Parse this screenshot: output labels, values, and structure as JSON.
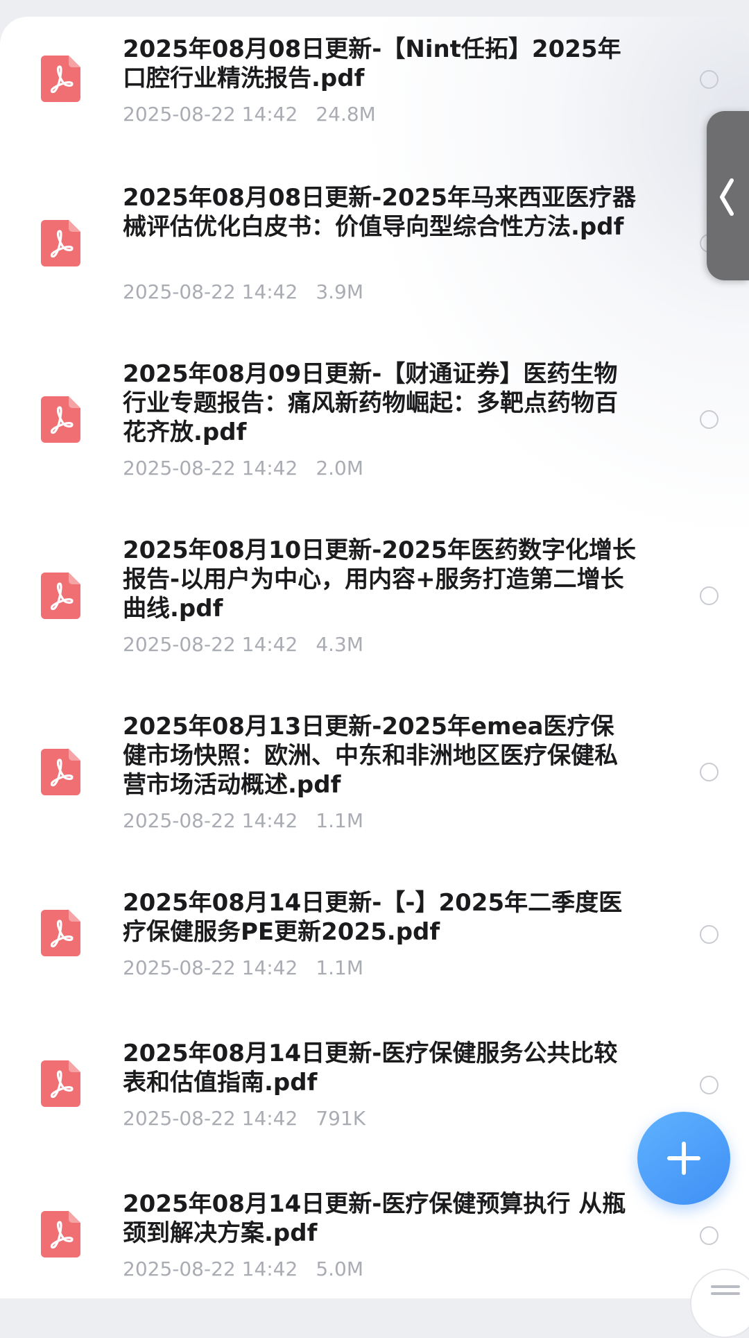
{
  "files": [
    {
      "name": "2025年08月08日更新-【Nint任拓】2025年口腔行业精洗报告.pdf",
      "date": "2025-08-22 14:42",
      "size": "24.8M"
    },
    {
      "name": "2025年08月08日更新-2025年马来西亚医疗器械评估优化白皮书：价值导向型综合性方法.pdf",
      "date": "2025-08-22 14:42",
      "size": "3.9M"
    },
    {
      "name": "2025年08月09日更新-【财通证券】医药生物行业专题报告：痛风新药物崛起：多靶点药物百花齐放.pdf",
      "date": "2025-08-22 14:42",
      "size": "2.0M"
    },
    {
      "name": "2025年08月10日更新-2025年医药数字化增长报告-以用户为中心，用内容+服务打造第二增长曲线.pdf",
      "date": "2025-08-22 14:42",
      "size": "4.3M"
    },
    {
      "name": "2025年08月13日更新-2025年emea医疗保健市场快照：欧洲、中东和非洲地区医疗保健私营市场活动概述.pdf",
      "date": "2025-08-22 14:42",
      "size": "1.1M"
    },
    {
      "name": "2025年08月14日更新-【-】2025年二季度医疗保健服务PE更新2025.pdf",
      "date": "2025-08-22 14:42",
      "size": "1.1M"
    },
    {
      "name": "2025年08月14日更新-医疗保健服务公共比较表和估值指南.pdf",
      "date": "2025-08-22 14:42",
      "size": "791K"
    },
    {
      "name": "2025年08月14日更新-医疗保健预算执行 从瓶颈到解决方案.pdf",
      "date": "2025-08-22 14:42",
      "size": "5.0M"
    }
  ],
  "icons": {
    "file_type": "pdf-file-icon",
    "select": "radio-circle-icon",
    "side_handle": "chevron-left-icon",
    "fab": "plus-icon",
    "bottom": "menu-lines-icon"
  },
  "colors": {
    "pdf_icon": "#ef6f73",
    "fab": "#4a9cf8",
    "title_text": "#1b1b1d",
    "meta_text": "#a9acb3",
    "side_handle": "#6e6e71"
  }
}
